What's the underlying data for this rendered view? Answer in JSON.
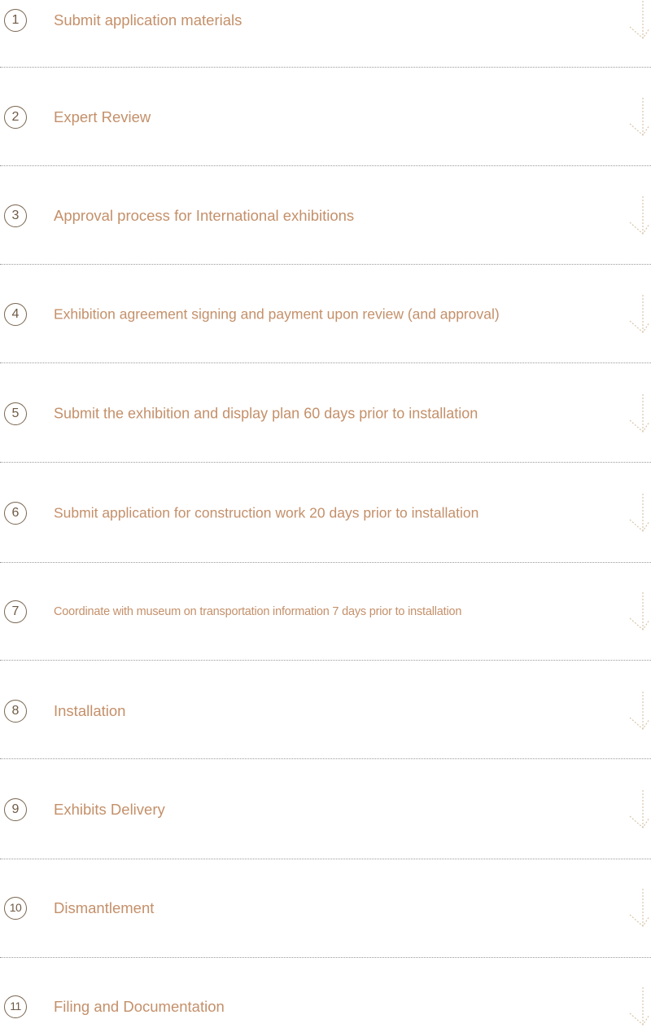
{
  "steps": [
    {
      "number": "1",
      "label": "Submit application materials"
    },
    {
      "number": "2",
      "label": "Expert Review"
    },
    {
      "number": "3",
      "label": "Approval process for International exhibitions"
    },
    {
      "number": "4",
      "label": "Exhibition agreement signing and payment upon review (and approval)"
    },
    {
      "number": "5",
      "label": "Submit the exhibition and display plan 60 days prior to installation"
    },
    {
      "number": "6",
      "label": "Submit application for construction work 20 days prior to installation"
    },
    {
      "number": "7",
      "label": "Coordinate with museum on transportation information 7 days prior to installation"
    },
    {
      "number": "8",
      "label": "Installation"
    },
    {
      "number": "9",
      "label": "Exhibits Delivery"
    },
    {
      "number": "10",
      "label": "Dismantlement"
    },
    {
      "number": "11",
      "label": "Filing and Documentation"
    }
  ],
  "icons": {
    "step_arrow": "arrow-down-icon"
  },
  "colors": {
    "label": "#c4906a",
    "number": "#6e5a45",
    "separator": "#9a9a9a",
    "arrow": "#d8c4a8"
  }
}
